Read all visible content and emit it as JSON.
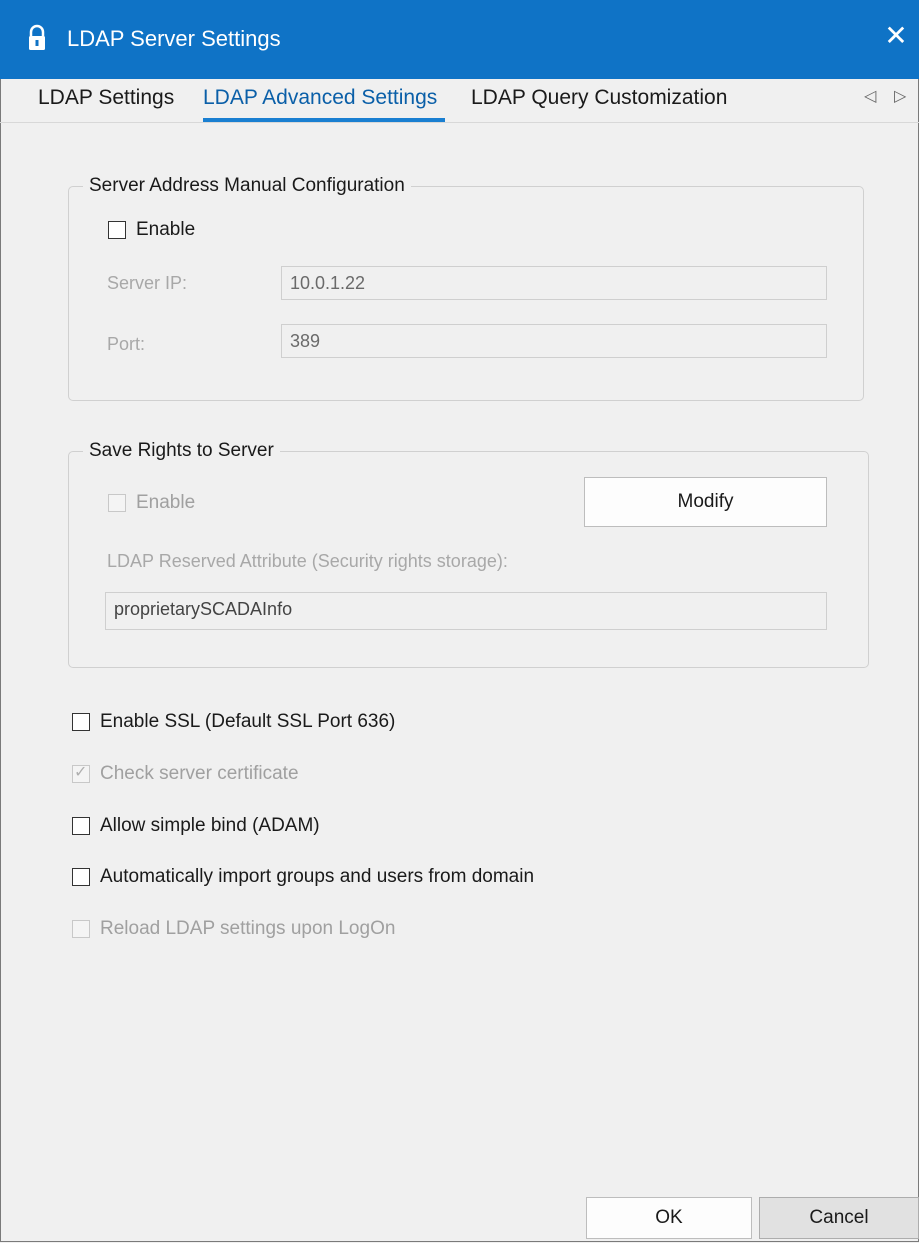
{
  "window": {
    "title": "LDAP Server Settings",
    "close_label": "✕",
    "icon": "lock-icon"
  },
  "tabs": [
    {
      "label": "LDAP Settings",
      "active": false
    },
    {
      "label": "LDAP Advanced Settings",
      "active": true
    },
    {
      "label": "LDAP Query Customization",
      "active": false
    }
  ],
  "tab_scroll": {
    "left": "◁",
    "right": "▷"
  },
  "server_address": {
    "legend": "Server Address Manual Configuration",
    "enable_label": "Enable",
    "enable_checked": false,
    "server_ip_label": "Server IP:",
    "server_ip_value": "10.0.1.22",
    "port_label": "Port:",
    "port_value": "389"
  },
  "save_rights": {
    "legend": "Save Rights to Server",
    "enable_label": "Enable",
    "enable_checked": false,
    "modify_label": "Modify",
    "attribute_label": "LDAP Reserved Attribute (Security rights storage):",
    "attribute_value": "proprietarySCADAInfo"
  },
  "options": {
    "enable_ssl": {
      "label": "Enable SSL (Default SSL Port 636)",
      "checked": false,
      "enabled": true
    },
    "check_cert": {
      "label": "Check server certificate",
      "checked": true,
      "enabled": false
    },
    "simple_bind": {
      "label": "Allow simple bind (ADAM)",
      "checked": false,
      "enabled": true
    },
    "auto_import": {
      "label": "Automatically import groups and users from domain",
      "checked": false,
      "enabled": true
    },
    "reload_logon": {
      "label": "Reload LDAP settings upon LogOn",
      "checked": false,
      "enabled": false
    }
  },
  "footer": {
    "ok_label": "OK",
    "cancel_label": "Cancel"
  },
  "colors": {
    "titlebar": "#0f73c6",
    "accent": "#1a7fd1"
  }
}
